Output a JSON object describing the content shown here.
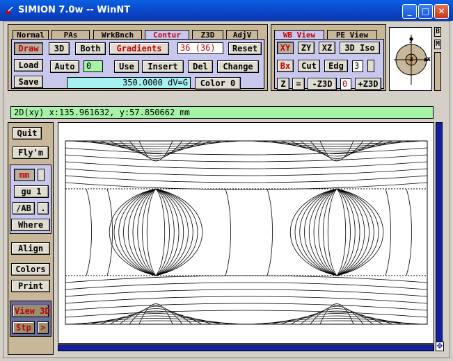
{
  "window": {
    "title": "SIMION 7.0w -- WinNT",
    "min": "_",
    "max": "□",
    "close": "✕"
  },
  "tabs_left": [
    {
      "label": "Normal",
      "active": false
    },
    {
      "label": "PAs",
      "active": false
    },
    {
      "label": "WrkBnch",
      "active": false
    },
    {
      "label": "Contur",
      "active": true
    },
    {
      "label": "Z3D",
      "active": false
    },
    {
      "label": "AdjV",
      "active": false
    }
  ],
  "tabs_right": [
    {
      "label": "WB View",
      "active": true
    },
    {
      "label": "PE View",
      "active": false
    }
  ],
  "contour_panel": {
    "draw": "Draw",
    "three_d": "3D",
    "both": "Both",
    "gradients": "Gradients",
    "count": "36 (36)",
    "reset": "Reset",
    "load": "Load",
    "auto": "Auto",
    "index": "0",
    "use": "Use",
    "insert": "Insert",
    "del": "Del",
    "change": "Change",
    "save": "Save",
    "value": "350.0000 dV=G",
    "color": "Color 0"
  },
  "view_panel": {
    "xy": "XY",
    "zy": "ZY",
    "xz": "XZ",
    "iso": "3D Iso",
    "bx": "Bx",
    "cut": "Cut",
    "edg": "Edg",
    "edg_val": "3",
    "z": "Z",
    "eq": "=",
    "minus_z3d": "-Z3D",
    "z3d_val": "0",
    "plus_z3d": "+Z3D"
  },
  "orient": {
    "y": "y",
    "x": "x",
    "z": "z"
  },
  "side_letters": {
    "b": "B",
    "m": "M"
  },
  "status": "2D(xy) x:135.961632, y:57.850662 mm",
  "left_panel": {
    "quit": "Quit",
    "flym": "Fly'm",
    "mm": "mm",
    "gu": "gu  1",
    "ab": "/AB",
    "dot": ".",
    "where": "Where",
    "align": "Align",
    "colors": "Colors",
    "print": "Print",
    "view3d": "View 3D",
    "stp": "Stp",
    "arrow": ">"
  },
  "corner_icon": "✥"
}
